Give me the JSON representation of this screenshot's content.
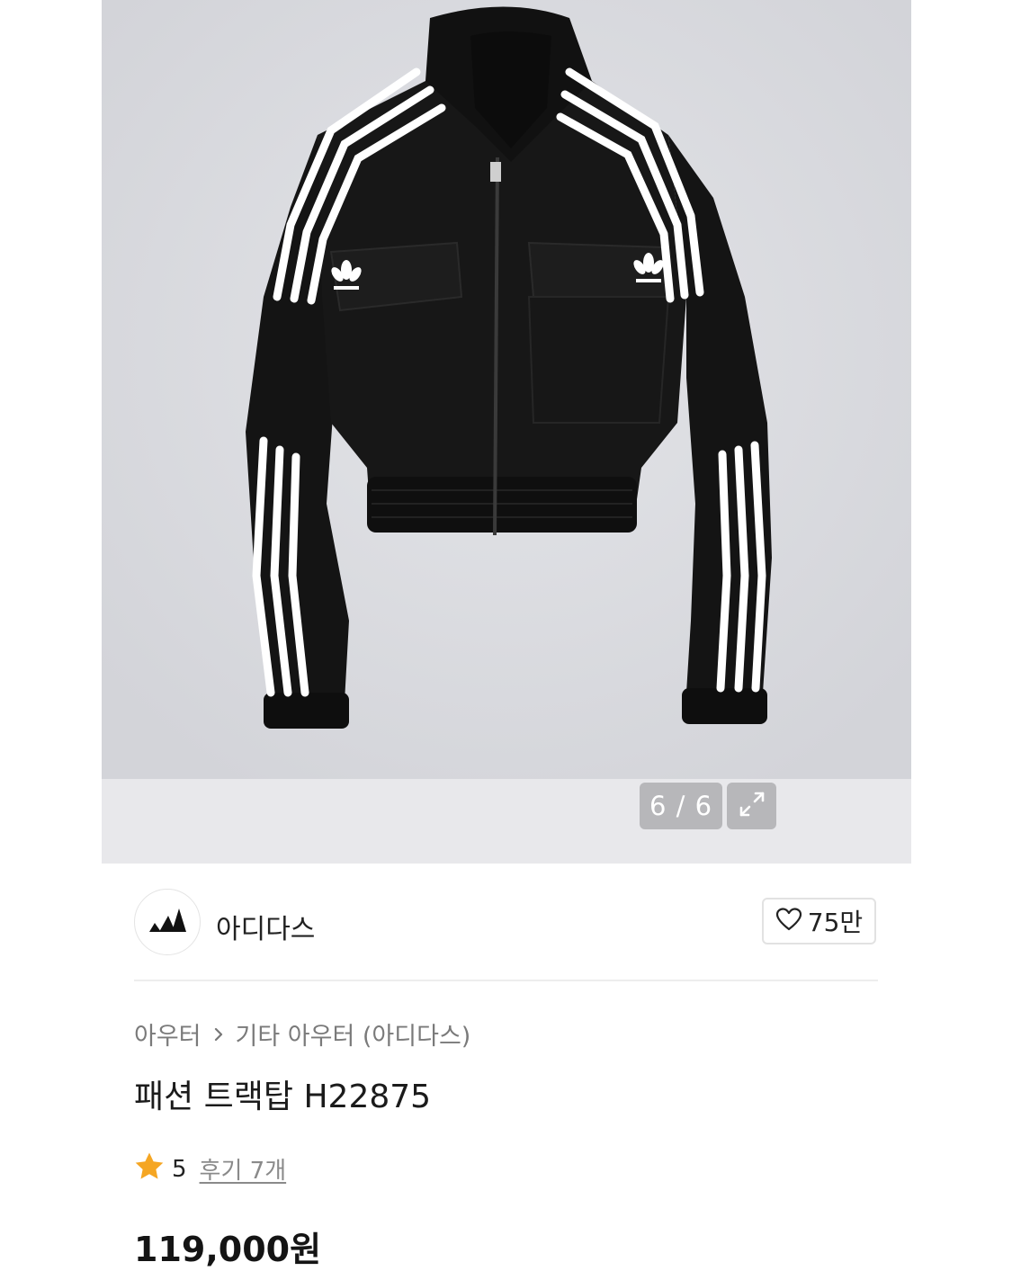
{
  "gallery": {
    "counter": "6 / 6",
    "expand_icon": "expand-icon",
    "product_image": "black track jacket with white three stripes"
  },
  "brand": {
    "logo_icon": "adidas-logo-icon",
    "name": "아디다스",
    "like_icon": "heart-icon",
    "like_count": "75만"
  },
  "breadcrumb": {
    "items": [
      "아우터",
      "기타 아우터 (아디다스)"
    ],
    "separator_icon": "chevron-right-icon"
  },
  "product": {
    "title": "패션 트랙탑 H22875",
    "rating_icon": "star-icon",
    "rating": "5",
    "review_link": "후기 7개",
    "price": "119,000원"
  },
  "colors": {
    "star": "#f5a623",
    "gallery_bg": "#dddee2",
    "counter_bg": "#b7b7ba"
  }
}
